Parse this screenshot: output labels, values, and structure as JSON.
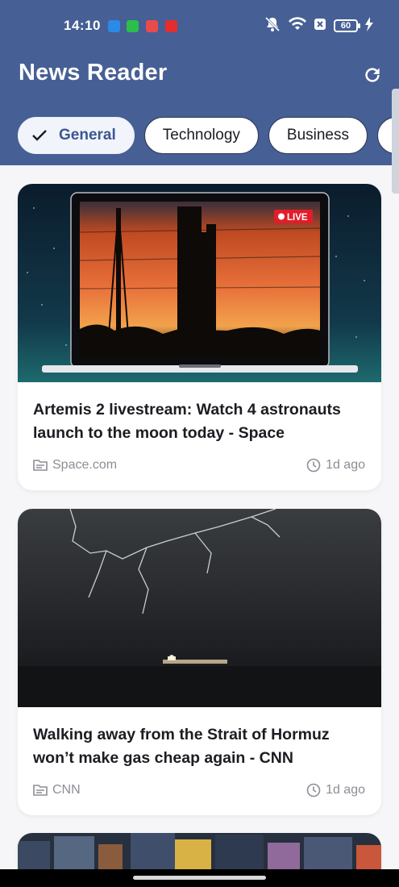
{
  "status_bar": {
    "time": "14:10",
    "battery": "60"
  },
  "app_bar": {
    "title": "News Reader"
  },
  "categories": [
    {
      "label": "General",
      "selected": true
    },
    {
      "label": "Technology",
      "selected": false
    },
    {
      "label": "Business",
      "selected": false
    },
    {
      "label": "S",
      "selected": false
    }
  ],
  "articles": [
    {
      "title": "Artemis 2 livestream: Watch 4 astronauts launch to the moon today - Space",
      "source": "Space.com",
      "time": "1d ago",
      "badge": "LIVE"
    },
    {
      "title": "Walking away from the Strait of Hormuz won’t make gas cheap again - CNN",
      "source": "CNN",
      "time": "1d ago"
    }
  ],
  "colors": {
    "header": "#465f95",
    "selected_chip_text": "#3c5691",
    "live_badge": "#e11d2a"
  }
}
